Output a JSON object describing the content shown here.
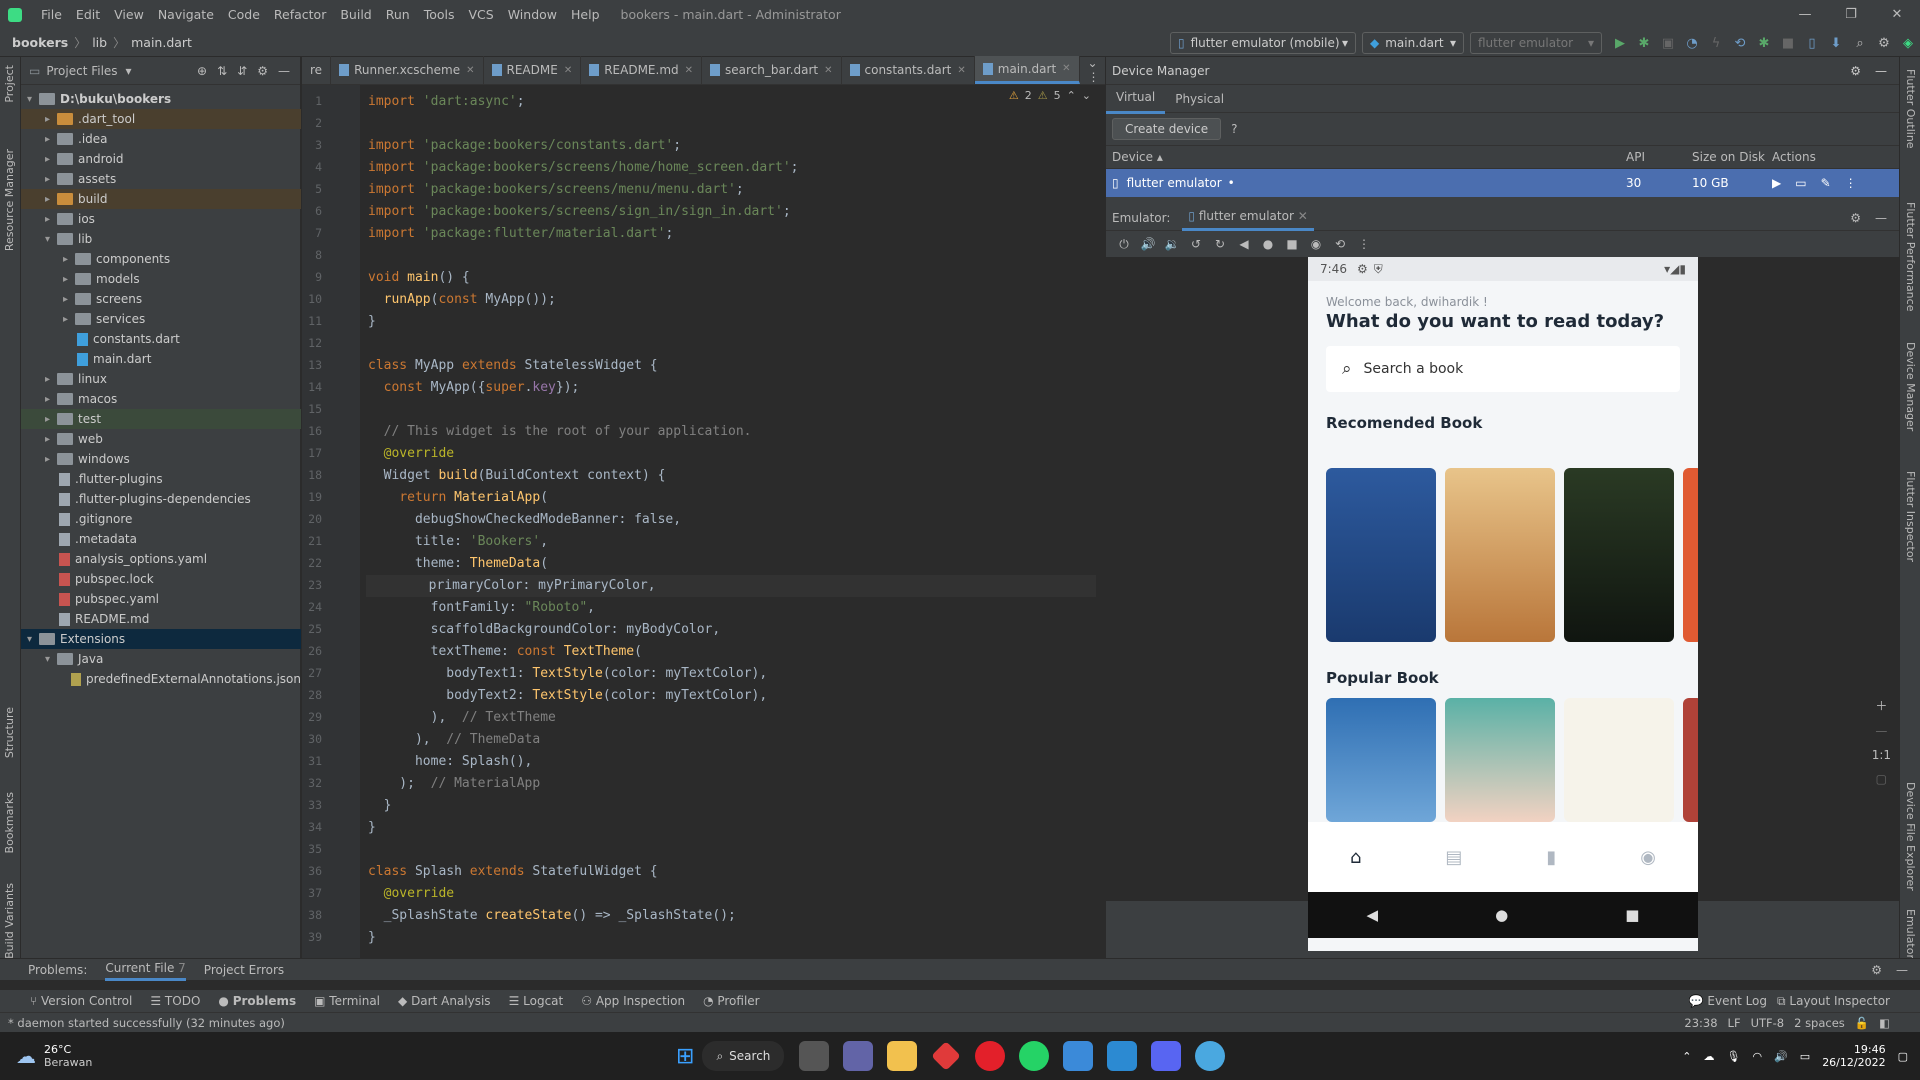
{
  "menu": {
    "items": [
      "File",
      "Edit",
      "View",
      "Navigate",
      "Code",
      "Refactor",
      "Build",
      "Run",
      "Tools",
      "VCS",
      "Window",
      "Help"
    ],
    "title": "bookers - main.dart - Administrator"
  },
  "nav": {
    "crumbs": [
      "bookers",
      "lib",
      "main.dart"
    ],
    "device_combo": "flutter emulator (mobile)",
    "config_combo": "main.dart",
    "disabled_combo": "flutter emulator"
  },
  "project": {
    "header": "Project Files",
    "tree": [
      {
        "label": "D:\\buku\\bookers",
        "depth": 0,
        "kind": "folder",
        "open": true,
        "bold": true
      },
      {
        "label": ".dart_tool",
        "depth": 1,
        "kind": "folder",
        "hl": "o"
      },
      {
        "label": ".idea",
        "depth": 1,
        "kind": "folder"
      },
      {
        "label": "android",
        "depth": 1,
        "kind": "folder"
      },
      {
        "label": "assets",
        "depth": 1,
        "kind": "folder"
      },
      {
        "label": "build",
        "depth": 1,
        "kind": "folder",
        "hl": "o"
      },
      {
        "label": "ios",
        "depth": 1,
        "kind": "folder"
      },
      {
        "label": "lib",
        "depth": 1,
        "kind": "folder",
        "open": true
      },
      {
        "label": "components",
        "depth": 2,
        "kind": "folder"
      },
      {
        "label": "models",
        "depth": 2,
        "kind": "folder"
      },
      {
        "label": "screens",
        "depth": 2,
        "kind": "folder"
      },
      {
        "label": "services",
        "depth": 2,
        "kind": "folder"
      },
      {
        "label": "constants.dart",
        "depth": 2,
        "kind": "dart",
        "leaf": true
      },
      {
        "label": "main.dart",
        "depth": 2,
        "kind": "dart",
        "leaf": true
      },
      {
        "label": "linux",
        "depth": 1,
        "kind": "folder"
      },
      {
        "label": "macos",
        "depth": 1,
        "kind": "folder"
      },
      {
        "label": "test",
        "depth": 1,
        "kind": "folder",
        "hl": "g"
      },
      {
        "label": "web",
        "depth": 1,
        "kind": "folder"
      },
      {
        "label": "windows",
        "depth": 1,
        "kind": "folder"
      },
      {
        "label": ".flutter-plugins",
        "depth": 1,
        "kind": "file",
        "leaf": true
      },
      {
        "label": ".flutter-plugins-dependencies",
        "depth": 1,
        "kind": "file",
        "leaf": true
      },
      {
        "label": ".gitignore",
        "depth": 1,
        "kind": "file",
        "leaf": true
      },
      {
        "label": ".metadata",
        "depth": 1,
        "kind": "file",
        "leaf": true
      },
      {
        "label": "analysis_options.yaml",
        "depth": 1,
        "kind": "yaml",
        "leaf": true
      },
      {
        "label": "pubspec.lock",
        "depth": 1,
        "kind": "yaml",
        "leaf": true
      },
      {
        "label": "pubspec.yaml",
        "depth": 1,
        "kind": "yaml",
        "leaf": true
      },
      {
        "label": "README.md",
        "depth": 1,
        "kind": "file",
        "leaf": true
      },
      {
        "label": "Extensions",
        "depth": 0,
        "kind": "folder",
        "open": true,
        "hl": "s"
      },
      {
        "label": "Java",
        "depth": 1,
        "kind": "folder",
        "open": true
      },
      {
        "label": "predefinedExternalAnnotations.json",
        "depth": 2,
        "kind": "json",
        "leaf": true
      }
    ]
  },
  "tabs": [
    {
      "label": "re",
      "partial": true
    },
    {
      "label": "Runner.xcscheme"
    },
    {
      "label": "README"
    },
    {
      "label": "README.md"
    },
    {
      "label": "search_bar.dart"
    },
    {
      "label": "constants.dart"
    },
    {
      "label": "main.dart",
      "active": true
    }
  ],
  "inspections": {
    "warnings": "2",
    "weak": "5"
  },
  "code": [
    "import 'dart:async';",
    "",
    "import 'package:bookers/constants.dart';",
    "import 'package:bookers/screens/home/home_screen.dart';",
    "import 'package:bookers/screens/menu/menu.dart';",
    "import 'package:bookers/screens/sign_in/sign_in.dart';",
    "import 'package:flutter/material.dart';",
    "",
    "void main() {",
    "  runApp(const MyApp());",
    "}",
    "",
    "class MyApp extends StatelessWidget {",
    "  const MyApp({super.key});",
    "",
    "  // This widget is the root of your application.",
    "  @override",
    "  Widget build(BuildContext context) {",
    "    return MaterialApp(",
    "      debugShowCheckedModeBanner: false,",
    "      title: 'Bookers',",
    "      theme: ThemeData(",
    "        primaryColor: myPrimaryColor,",
    "        fontFamily: \"Roboto\",",
    "        scaffoldBackgroundColor: myBodyColor,",
    "        textTheme: const TextTheme(",
    "          bodyText1: TextStyle(color: myTextColor),",
    "          bodyText2: TextStyle(color: myTextColor),",
    "        ),  // TextTheme",
    "      ),  // ThemeData",
    "      home: Splash(),",
    "    );  // MaterialApp",
    "  }",
    "}",
    "",
    "class Splash extends StatefulWidget {",
    "  @override",
    "  _SplashState createState() => _SplashState();",
    "}"
  ],
  "devmgr": {
    "title": "Device Manager",
    "tabs": [
      "Virtual",
      "Physical"
    ],
    "create": "Create device",
    "help": "?",
    "cols": [
      "Device",
      "API",
      "Size on Disk",
      "Actions"
    ],
    "row": {
      "device": "flutter emulator",
      "api": "30",
      "size": "10 GB"
    }
  },
  "emulator": {
    "label": "Emulator:",
    "tab": "flutter emulator",
    "zoom": "1:1"
  },
  "phone": {
    "time": "7:46",
    "welcome": "Welcome back, dwihardik !",
    "heading": "What do you want to read today?",
    "search": "Search a book",
    "sec1": "Recomended Book",
    "sec2": "Popular Book"
  },
  "problems": {
    "label": "Problems:",
    "tabs": [
      "Current File",
      "Project Errors"
    ],
    "count": "7"
  },
  "toolwin": {
    "items": [
      "Version Control",
      "TODO",
      "Problems",
      "Terminal",
      "Dart Analysis",
      "Logcat",
      "App Inspection",
      "Profiler"
    ],
    "right": [
      "Event Log",
      "Layout Inspector"
    ]
  },
  "status": {
    "msg": "* daemon started successfully (32 minutes ago)",
    "pos": "23:38",
    "le": "LF",
    "enc": "UTF-8",
    "indent": "2 spaces"
  },
  "taskbar": {
    "temp": "26°C",
    "weather": "Berawan",
    "search": "Search",
    "time": "19:46",
    "date": "26/12/2022"
  },
  "sidebars": {
    "left": [
      "Project",
      "Resource Manager",
      "Structure",
      "Bookmarks",
      "Build Variants"
    ],
    "right": [
      "Flutter Outline",
      "Flutter Performance",
      "Device Manager",
      "Flutter Inspector",
      "Device File Explorer",
      "Emulator"
    ]
  },
  "colors": {
    "accent": "#4a88c7",
    "selection": "#4b6eaf"
  }
}
